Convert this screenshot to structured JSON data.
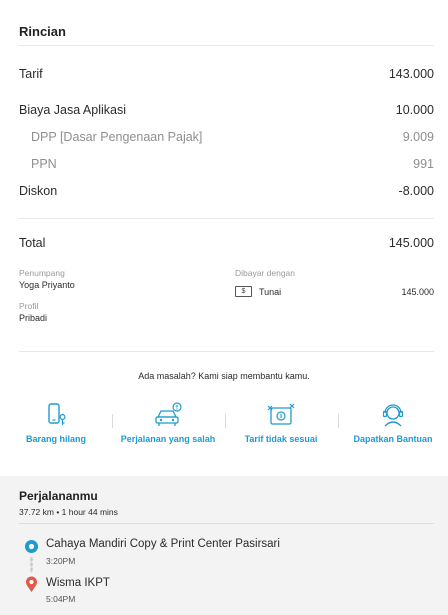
{
  "details": {
    "title": "Rincian",
    "fare": {
      "label": "Tarif",
      "value": "143.000"
    },
    "app_fee": {
      "label": "Biaya Jasa Aplikasi",
      "value": "10.000"
    },
    "dpp": {
      "label": "DPP [Dasar Pengenaan Pajak]",
      "value": "9.009"
    },
    "ppn": {
      "label": "PPN",
      "value": "991"
    },
    "discount": {
      "label": "Diskon",
      "value": "-8.000"
    },
    "total": {
      "label": "Total",
      "value": "145.000"
    },
    "passenger": {
      "label": "Penumpang",
      "value": "Yoga Priyanto"
    },
    "paid_with": {
      "label": "Dibayar dengan",
      "method": "Tunai",
      "amount": "145.000",
      "icon_glyph": "$"
    },
    "profile": {
      "label": "Profil",
      "value": "Pribadi"
    }
  },
  "help": {
    "prompt": "Ada masalah? Kami siap membantu kamu.",
    "actions": [
      {
        "label": "Barang hilang",
        "icon": "lost-phone-icon"
      },
      {
        "label": "Perjalanan yang salah",
        "icon": "wrong-trip-car-icon"
      },
      {
        "label": "Tarif tidak sesuai",
        "icon": "fare-mismatch-icon"
      },
      {
        "label": "Dapatkan Bantuan",
        "icon": "support-agent-icon"
      }
    ]
  },
  "trip": {
    "title": "Perjalananmu",
    "summary": "37.72 km • 1 hour 44 mins",
    "pickup": {
      "name": "Cahaya Mandiri Copy & Print Center Pasirsari",
      "time": "3:20PM"
    },
    "dropoff": {
      "name": "Wisma IKPT",
      "time": "5:04PM"
    }
  },
  "colors": {
    "accent": "#1f9bcf",
    "pickup_marker": "#1f9bcf",
    "dropoff_marker": "#e05a47",
    "trip_bg": "#f3f3f3"
  }
}
